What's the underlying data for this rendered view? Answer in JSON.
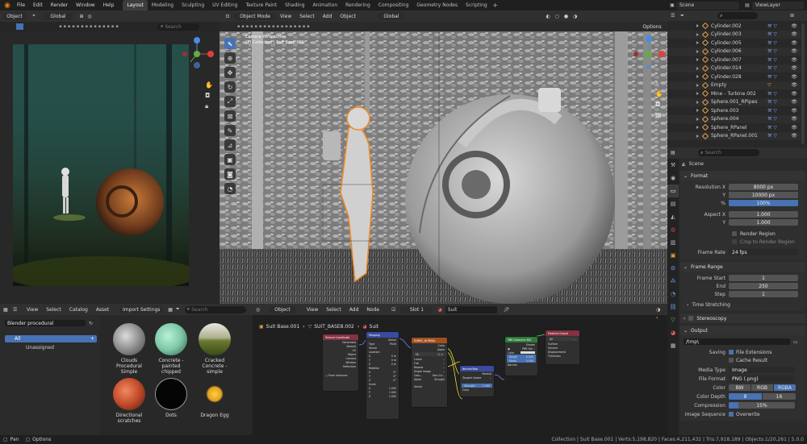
{
  "topbar": {
    "menus": [
      "File",
      "Edit",
      "Render",
      "Window",
      "Help"
    ],
    "workspaces": [
      "Layout",
      "Modeling",
      "Sculpting",
      "UV Editing",
      "Texture Paint",
      "Shading",
      "Animation",
      "Rendering",
      "Compositing",
      "Geometry Nodes",
      "Scripting"
    ],
    "active_workspace": "Layout",
    "scene": "Scene",
    "view_layer": "ViewLayer"
  },
  "image_editor": {
    "mode": "Object",
    "orientation": "Global",
    "search_placeholder": "Search"
  },
  "viewport": {
    "mode": "Object Mode",
    "menus": [
      "View",
      "Select",
      "Add",
      "Object"
    ],
    "orientation": "Global",
    "options": "Options",
    "camera_label_1": "Camera Perspective",
    "camera_label_2": "(1) Collection | Suit Base.001"
  },
  "outliner": {
    "search_placeholder": "",
    "items": [
      "Cylinder.002",
      "Cylinder.003",
      "Cylinder.005",
      "Cylinder.006",
      "Cylinder.007",
      "Cylinder.014",
      "Cylinder.028",
      "Empty",
      "Mine - Turbine.002",
      "Sphere.001_RPipes",
      "Sphere.003",
      "Sphere.004",
      "Sphere_RPanel",
      "Sphere_RPanel.001"
    ]
  },
  "properties": {
    "search_placeholder": "Search",
    "scene_name": "Scene",
    "format": {
      "header": "Format",
      "resolution_x_label": "Resolution X",
      "resolution_x": "8000 px",
      "y_label": "Y",
      "resolution_y": "10000 px",
      "pct_label": "%",
      "resolution_pct": "100%",
      "aspect_x_label": "Aspect X",
      "aspect_x": "1.000",
      "aspect_y_label": "Y",
      "aspect_y": "1.000",
      "render_region": "Render Region",
      "crop_region": "Crop to Render Region",
      "frame_rate_label": "Frame Rate",
      "frame_rate": "24 fps"
    },
    "frame_range": {
      "header": "Frame Range",
      "start_label": "Frame Start",
      "start": "1",
      "end_label": "End",
      "end": "250",
      "step_label": "Step",
      "step": "1"
    },
    "time_stretching": "Time Stretching",
    "stereoscopy": "Stereoscopy",
    "output": {
      "header": "Output",
      "path": "/tmp\\",
      "saving_label": "Saving",
      "file_extensions": "File Extensions",
      "cache_result": "Cache Result",
      "media_type_label": "Media Type",
      "media_type": "Image",
      "file_format_label": "File Format",
      "file_format": "PNG (.png)",
      "color_label": "Color",
      "color_options": [
        "BW",
        "RGB",
        "RGBA"
      ],
      "color_selected": "RGBA",
      "color_depth_label": "Color Depth",
      "color_depth_options": [
        "8",
        "16"
      ],
      "compression_label": "Compression",
      "compression": "15%",
      "image_sequence_label": "Image Sequence",
      "overwrite": "Overwrite"
    }
  },
  "asset_browser": {
    "menus": [
      "View",
      "Select",
      "Catalog",
      "Asset"
    ],
    "import_settings": "Import Settings",
    "search_placeholder": "Search",
    "library": "Blender procedural",
    "catalog_all": "All",
    "catalog_unassigned": "Unassigned",
    "assets": [
      {
        "name": "Clouds Procedural Simple",
        "color": "#c8c8c8"
      },
      {
        "name": "Concrete - painted chipped",
        "color": "#7fc8a8"
      },
      {
        "name": "Cracked Concrete - simple",
        "color": "#9aa070"
      },
      {
        "name": "Directional scratches",
        "color": "#c24a2a"
      },
      {
        "name": "Dots",
        "color": "#050505"
      },
      {
        "name": "Dragon Egg",
        "color": "#e0a020"
      }
    ]
  },
  "node_editor": {
    "object_label": "Object",
    "menus": [
      "View",
      "Select",
      "Add",
      "Node"
    ],
    "slot": "Slot 1",
    "material": "Suit",
    "breadcrumb": [
      "Suit Base.001",
      "SUIT_BASE8.002",
      "Suit"
    ],
    "nodes": {
      "texcoord": "Texture Coordinate",
      "mapping": "Mapping",
      "image": "FABRIC_NORMAL",
      "normal_map": "Normal Map",
      "bsdf": "PBR Dielectric BS1",
      "output": "Material Output"
    }
  },
  "statusbar": {
    "left_1": "Pan",
    "left_2": "Options",
    "right": "Collection | Suit Base.001 | Verts:5,198,820 | Faces:4,211,432 | Tris:7,918,189 | Objects:1/20,261 | 5.0.0"
  }
}
